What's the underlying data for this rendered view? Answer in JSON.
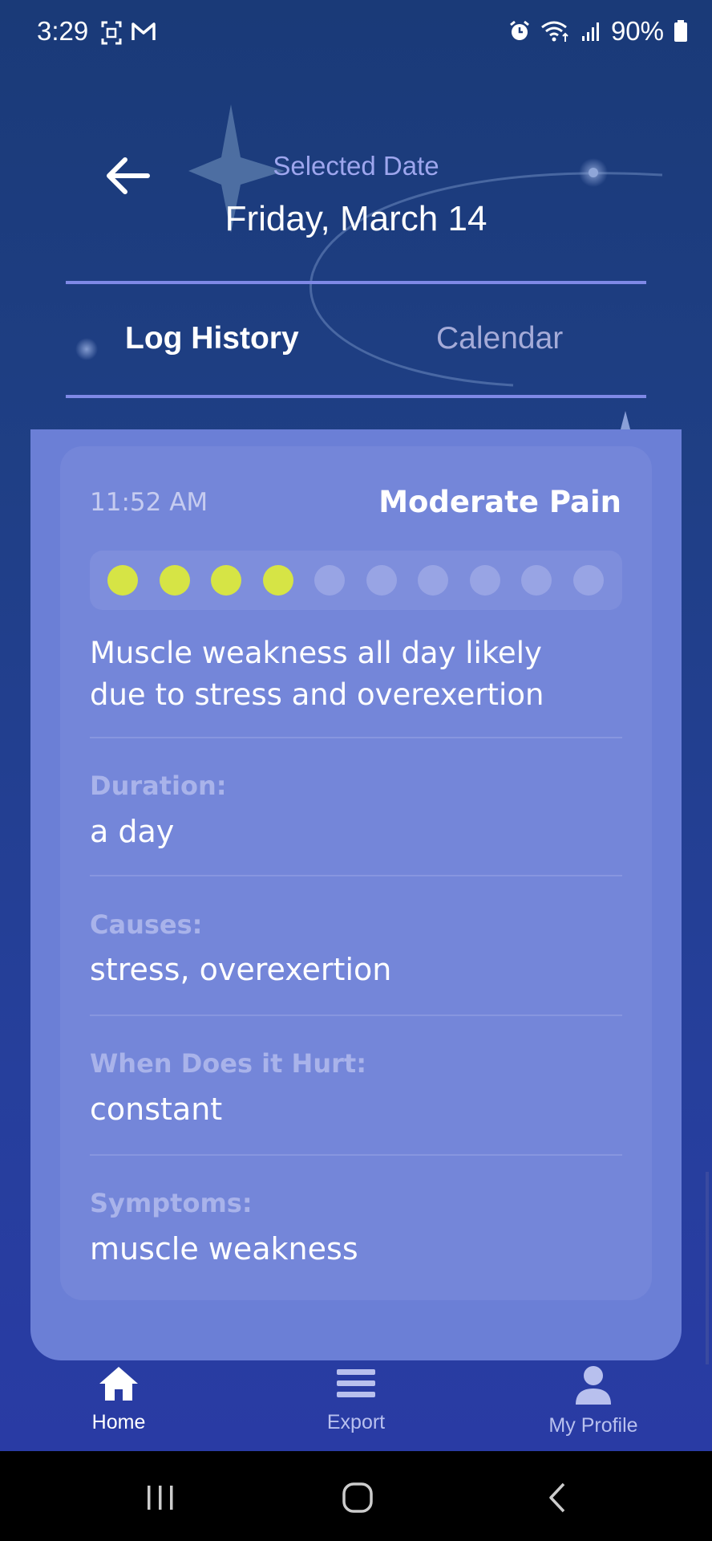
{
  "status_bar": {
    "time": "3:29",
    "battery": "90%"
  },
  "header": {
    "selected_label": "Selected Date",
    "selected_date": "Friday, March 14"
  },
  "tabs": [
    {
      "label": "Log History",
      "active": true
    },
    {
      "label": "Calendar",
      "active": false
    }
  ],
  "entry": {
    "time": "11:52 AM",
    "level_label": "Moderate Pain",
    "pain_level": 4,
    "pain_max": 10,
    "note": "Muscle weakness all day likely due to stress and overexertion",
    "fields": [
      {
        "label": "Duration:",
        "value": "a day"
      },
      {
        "label": "Causes:",
        "value": "stress, overexertion"
      },
      {
        "label": "When Does it Hurt:",
        "value": "constant"
      },
      {
        "label": "Symptoms:",
        "value": "muscle weakness"
      }
    ]
  },
  "nav": {
    "home": "Home",
    "export": "Export",
    "profile": "My Profile"
  },
  "colors": {
    "accent_dot": "#d6e445",
    "card": "#7486d9",
    "background": "#1f3f85"
  }
}
